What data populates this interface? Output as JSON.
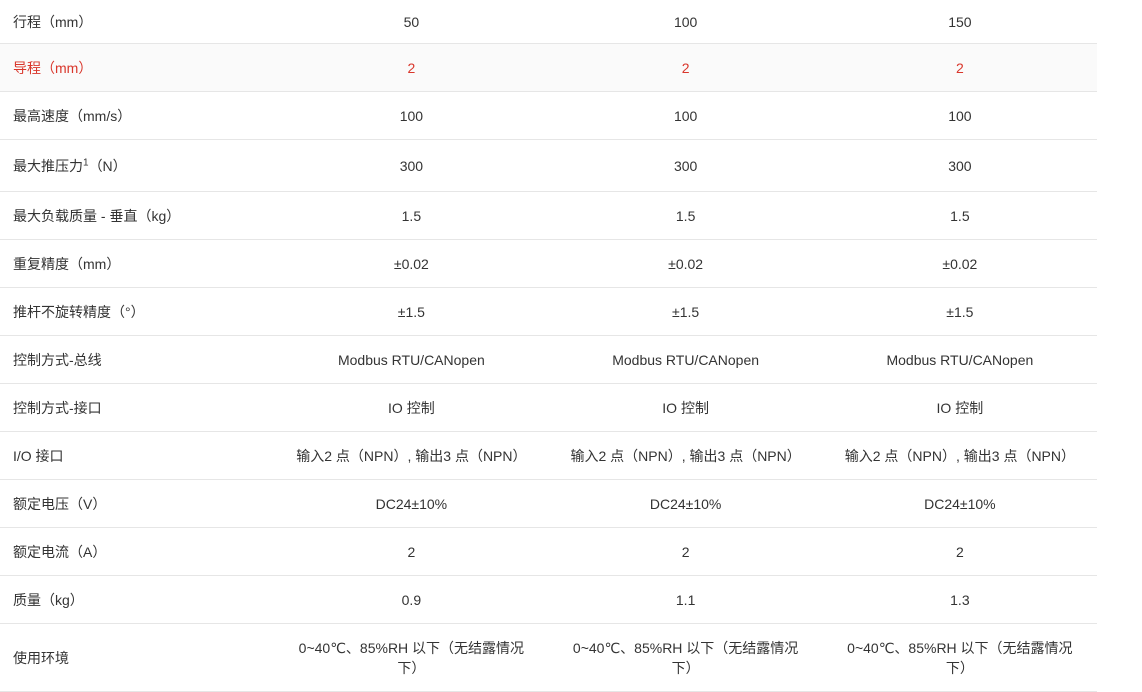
{
  "rows": [
    {
      "label": "行程（mm）",
      "values": [
        "50",
        "100",
        "150"
      ]
    },
    {
      "label": "导程（mm）",
      "values": [
        "2",
        "2",
        "2"
      ]
    },
    {
      "label": "最高速度（mm/s）",
      "values": [
        "100",
        "100",
        "100"
      ]
    },
    {
      "label_pre": "最大推压力",
      "label_sup": "1",
      "label_post": "（N）",
      "values": [
        "300",
        "300",
        "300"
      ]
    },
    {
      "label": "最大负载质量 - 垂直（kg）",
      "values": [
        "1.5",
        "1.5",
        "1.5"
      ]
    },
    {
      "label": "重复精度（mm）",
      "values": [
        "±0.02",
        "±0.02",
        "±0.02"
      ]
    },
    {
      "label": "推杆不旋转精度（°）",
      "values": [
        "±1.5",
        "±1.5",
        "±1.5"
      ]
    },
    {
      "label": "控制方式-总线",
      "values": [
        "Modbus RTU/CANopen",
        "Modbus RTU/CANopen",
        "Modbus RTU/CANopen"
      ]
    },
    {
      "label": "控制方式-接口",
      "values": [
        "IO 控制",
        "IO 控制",
        "IO 控制"
      ]
    },
    {
      "label": "I/O 接口",
      "values": [
        "输入2 点（NPN）, 输出3 点（NPN）",
        "输入2 点（NPN）, 输出3 点（NPN）",
        "输入2 点（NPN）, 输出3 点（NPN）"
      ]
    },
    {
      "label": "额定电压（V）",
      "values": [
        "DC24±10%",
        "DC24±10%",
        "DC24±10%"
      ]
    },
    {
      "label": "额定电流（A）",
      "values": [
        "2",
        "2",
        "2"
      ]
    },
    {
      "label": "质量（kg）",
      "values": [
        "0.9",
        "1.1",
        "1.3"
      ]
    },
    {
      "label": "使用环境",
      "values": [
        "0~40℃、85%RH 以下（无结露情况下）",
        "0~40℃、85%RH 以下（无结露情况下）",
        "0~40℃、85%RH 以下（无结露情况下）"
      ]
    }
  ],
  "colors": {
    "text": "#333333",
    "highlight_text": "#d9362b",
    "highlight_bg": "#fafafa",
    "border": "#e6e6e6"
  }
}
